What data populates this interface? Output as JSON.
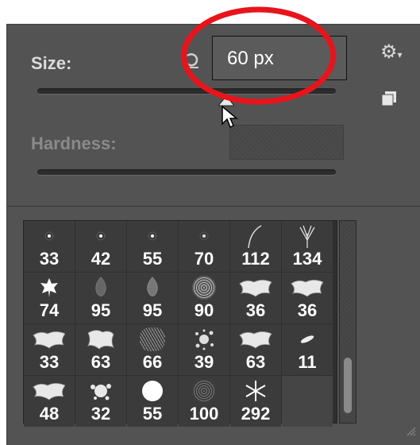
{
  "panel": {
    "size_label": "Size:",
    "size_value": "60 px",
    "hardness_label": "Hardness:"
  },
  "brushes": [
    {
      "size": "33",
      "icon": "soft-dot-icon"
    },
    {
      "size": "42",
      "icon": "soft-dot-icon"
    },
    {
      "size": "55",
      "icon": "soft-dot-icon"
    },
    {
      "size": "70",
      "icon": "soft-dot-icon"
    },
    {
      "size": "112",
      "icon": "grass-stroke-icon"
    },
    {
      "size": "134",
      "icon": "grass-tuft-icon"
    },
    {
      "size": "74",
      "icon": "maple-leaf-icon"
    },
    {
      "size": "95",
      "icon": "leaf-icon"
    },
    {
      "size": "95",
      "icon": "leaf-icon"
    },
    {
      "size": "90",
      "icon": "scatter-texture-icon"
    },
    {
      "size": "36",
      "icon": "chalk-texture-icon"
    },
    {
      "size": "36",
      "icon": "chalk-texture-icon"
    },
    {
      "size": "33",
      "icon": "chalk-texture-icon"
    },
    {
      "size": "63",
      "icon": "chalk-texture-icon"
    },
    {
      "size": "66",
      "icon": "spray-texture-icon"
    },
    {
      "size": "39",
      "icon": "splatter-icon"
    },
    {
      "size": "63",
      "icon": "chalk-texture-icon"
    },
    {
      "size": "11",
      "icon": "streak-icon"
    },
    {
      "size": "48",
      "icon": "chalk-texture-icon"
    },
    {
      "size": "32",
      "icon": "splatter-icon"
    },
    {
      "size": "55",
      "icon": "hard-round-icon"
    },
    {
      "size": "100",
      "icon": "spray-texture-icon"
    },
    {
      "size": "292",
      "icon": "snowflake-icon"
    },
    {
      "size": "",
      "icon": ""
    }
  ],
  "colors": {
    "panel_bg": "#535353",
    "highlight_ring": "#e8141c",
    "text": "#ffffff"
  }
}
